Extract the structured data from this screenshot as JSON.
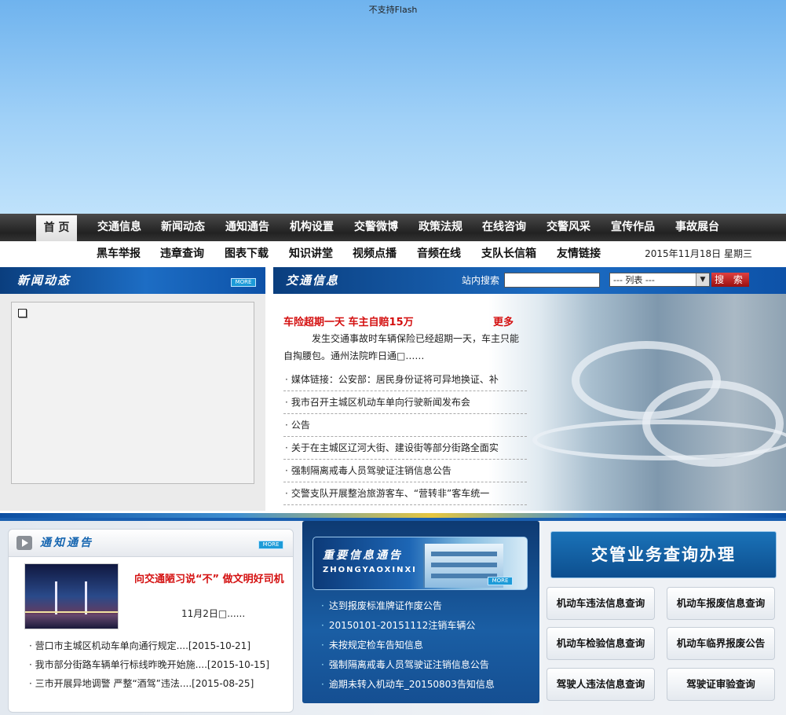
{
  "banner": {
    "flash_text": "不支持Flash"
  },
  "nav_primary": {
    "home": "首 页",
    "items": [
      "交通信息",
      "新闻动态",
      "通知通告",
      "机构设置",
      "交警微博",
      "政策法规",
      "在线咨询",
      "交警风采",
      "宣传作品",
      "事故展台"
    ]
  },
  "nav_secondary": {
    "items": [
      "黑车举报",
      "违章查询",
      "图表下载",
      "知识讲堂",
      "视频点播",
      "音频在线",
      "支队长信箱",
      "友情链接"
    ],
    "date": "2015年11月18日 星期三"
  },
  "news_dynamics": {
    "title": "新闻动态",
    "more": "MORE"
  },
  "traffic_info": {
    "title": "交通信息",
    "search_label": "站内搜索",
    "search_value": "",
    "select_value": "--- 列表 ---",
    "search_button": "搜 索",
    "headline": "车险超期一天 车主自赔15万",
    "more_label": "更多",
    "summary": "发生交通事故时车辆保险已经超期一天，车主只能自掏腰包。通州法院昨日通□……",
    "items": [
      "媒体链接：公安部：居民身份证将可异地换证、补",
      "我市召开主城区机动车单向行驶新闻发布会",
      "公告",
      "关于在主城区辽河大街、建设街等部分街路全面实",
      "强制隔离戒毒人员驾驶证注销信息公告",
      "交警支队开展整治旅游客车、“营转非”客车统一"
    ]
  },
  "notice": {
    "title": "通知通告",
    "more": "MORE",
    "featured_title": "向交通陋习说“不” 做文明好司机",
    "featured_date": "11月2日□......",
    "items": [
      "营口市主城区机动车单向通行规定....[2015-10-21]",
      "我市部分街路车辆单行标线昨晚开始施....[2015-10-15]",
      "三市开展异地调警 严整“酒驾”违法....[2015-08-25]"
    ]
  },
  "important": {
    "title": "重要信息通告",
    "subtitle": "ZHONGYAOXINXI",
    "more": "MORE",
    "items": [
      "达到报废标准牌证作废公告",
      "20150101-20151112注销车辆公",
      "未按规定检车告知信息",
      "强制隔离戒毒人员驾驶证注销信息公告",
      "逾期未转入机动车_20150803告知信息"
    ]
  },
  "service": {
    "title": "交管业务查询办理",
    "buttons": [
      "机动车违法信息查询",
      "机动车报废信息查询",
      "机动车检验信息查询",
      "机动车临界报废公告",
      "驾驶人违法信息查询",
      "驾驶证审验查询"
    ]
  },
  "colors": {
    "accent_red": "#d41010",
    "nav_dark": "#222222",
    "bar_blue": "#1d6dc4",
    "link_blue": "#1565b0"
  }
}
